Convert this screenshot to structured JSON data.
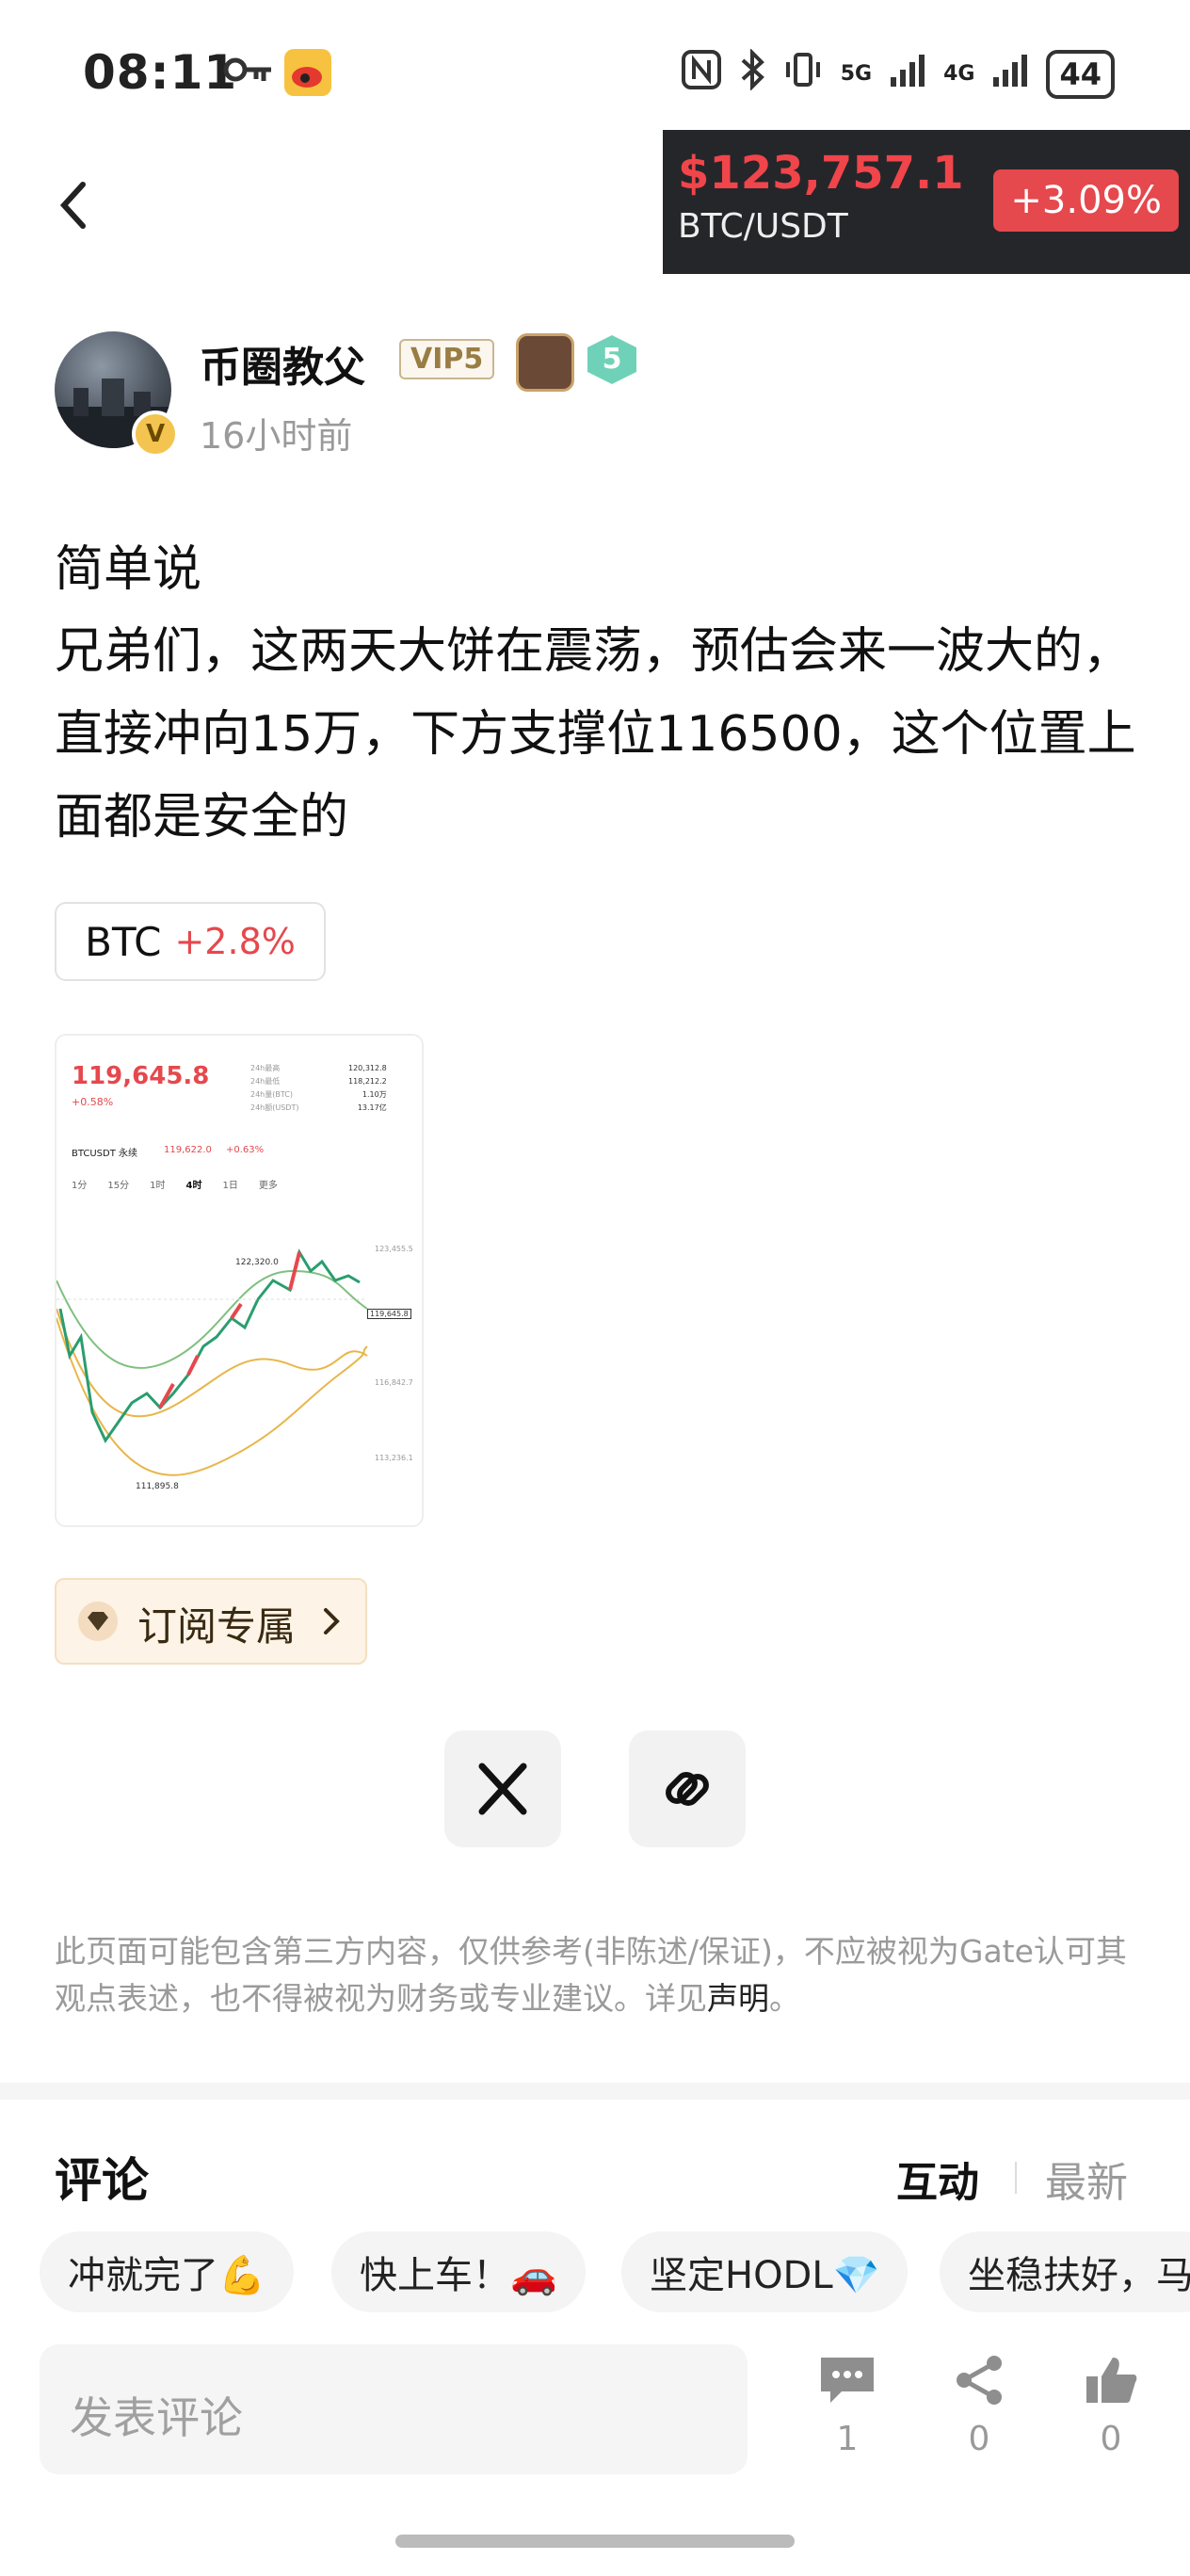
{
  "status_bar": {
    "time": "08:11",
    "battery": "44",
    "net1": "5G",
    "net2": "4G"
  },
  "ticker": {
    "price": "$123,757.1",
    "pair": "BTC/USDT",
    "change": "+3.09%"
  },
  "author": {
    "name": "币圈教父",
    "vip": "VIP5",
    "level": "5",
    "time_ago": "16小时前",
    "avatar_badge": "V"
  },
  "post": {
    "title": "简单说",
    "body": "兄弟们，这两天大饼在震荡，预估会来一波大的，直接冲向15万，下方支撑位116500，这个位置上面都是安全的"
  },
  "tag": {
    "symbol": "BTC",
    "change": "+2.8%"
  },
  "thumbnail": {
    "price": "119,645.8",
    "change": "+0.58%",
    "pair": "BTCUSDT 永续",
    "pair_price": "119,622.0",
    "pair_change": "+0.63%",
    "high_label": "24h最高",
    "high": "120,312.8",
    "low_label": "24h最低",
    "low": "118,212.2",
    "vol_btc_label": "24h量(BTC)",
    "vol_btc": "1.10万",
    "vol_usdt_label": "24h额(USDT)",
    "vol_usdt": "13.17亿",
    "tabs": [
      "1分",
      "15分",
      "1时",
      "4时",
      "1日",
      "更多"
    ],
    "peak": "122,320.0",
    "trough": "111,895.8",
    "axis": [
      "123,455.5",
      "119,645.8",
      "116,842.7",
      "113,236.1"
    ]
  },
  "subscribe": {
    "label": "订阅专属"
  },
  "disclaimer": {
    "text": "此页面可能包含第三方内容，仅供参考(非陈述/保证)，不应被视为Gate认可其观点表述，也不得被视为财务或专业建议。详见",
    "link": "声明",
    "end": "。"
  },
  "comments": {
    "title": "评论",
    "sort_active": "互动",
    "sort_latest": "最新",
    "quick_replies": [
      "冲就完了💪",
      "快上车！🚗",
      "坚定HODL💎",
      "坐稳扶好，马"
    ]
  },
  "bottom_bar": {
    "placeholder": "发表评论",
    "comment_count": "1",
    "share_count": "0",
    "like_count": "0"
  },
  "colors": {
    "accent_red": "#e5484d",
    "ticker_bg": "#25262a"
  }
}
